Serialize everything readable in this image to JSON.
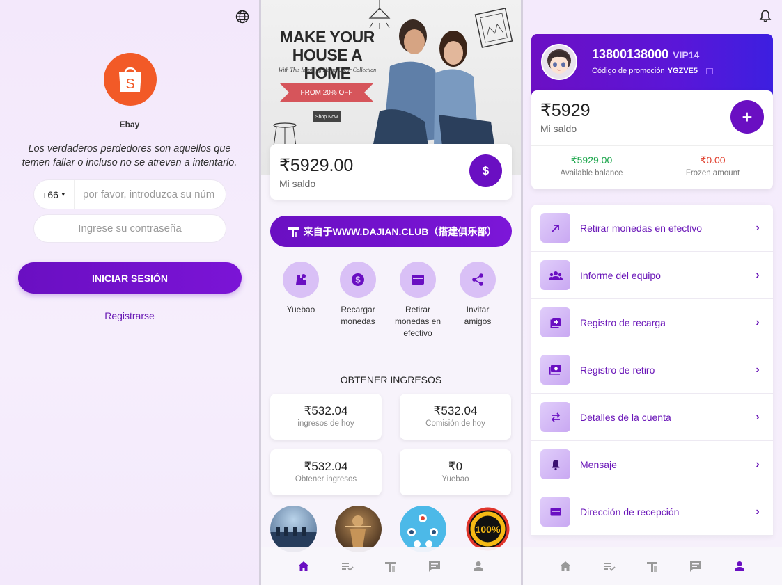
{
  "login": {
    "brand": "Ebay",
    "quote": "Los verdaderos perdedores son aquellos que temen fallar o incluso no se atreven a intentarlo.",
    "country_code": "+66",
    "phone_placeholder": "por favor, introduzca su núm",
    "password_placeholder": "Ingrese su contraseña",
    "login_label": "INICIAR SESIÓN",
    "register_label": "Registrarse"
  },
  "home": {
    "banner": {
      "title": "MAKE YOUR HOUSE A HOME",
      "subtitle": "With This Inspiring Home Decor Collection",
      "badge": "FROM 20% OFF",
      "button": "Shop Now"
    },
    "balance": {
      "amount": "₹5929.00",
      "label": "Mi saldo",
      "button": "$"
    },
    "club_button": "来自于WWW.DAJIAN.CLUB（搭建俱乐部）",
    "quick_actions": [
      {
        "label": "Yuebao",
        "icon": "yuebao-icon"
      },
      {
        "label": "Recargar monedas",
        "icon": "coin-icon"
      },
      {
        "label": "Retirar monedas en efectivo",
        "icon": "card-icon"
      },
      {
        "label": "Invitar amigos",
        "icon": "share-icon"
      }
    ],
    "section_title": "OBTENER INGRESOS",
    "stats": [
      {
        "value": "₹532.04",
        "label": "ingresos de hoy"
      },
      {
        "value": "₹532.04",
        "label": "Comisión de hoy"
      },
      {
        "value": "₹532.04",
        "label": "Obtener ingresos"
      },
      {
        "value": "₹0",
        "label": "Yuebao"
      }
    ],
    "badge_text": "SATISFACTION 100% GUARANTEED"
  },
  "profile": {
    "name": "13800138000",
    "vip": "VIP14",
    "promo_label": "Código de promoción",
    "promo_code": "YGZVE5",
    "balance": "₹5929",
    "balance_label": "Mi saldo",
    "available_value": "₹5929.00",
    "available_label": "Available balance",
    "frozen_value": "₹0.00",
    "frozen_label": "Frozen amount",
    "menu": [
      {
        "label": "Retirar monedas en efectivo",
        "icon": "arrow-up-right-icon"
      },
      {
        "label": "Informe del equipo",
        "icon": "team-icon"
      },
      {
        "label": "Registro de recarga",
        "icon": "add-box-icon"
      },
      {
        "label": "Registro de retiro",
        "icon": "money-icon"
      },
      {
        "label": "Detalles de la cuenta",
        "icon": "swap-icon"
      },
      {
        "label": "Mensaje",
        "icon": "bell-icon"
      },
      {
        "label": "Dirección de recepción",
        "icon": "card-icon"
      }
    ]
  },
  "nav": [
    "home-icon",
    "tasks-icon",
    "service-icon",
    "message-icon",
    "user-icon"
  ],
  "colors": {
    "primary": "#6a0fc2",
    "accent_green": "#1aa54a",
    "accent_red": "#e0412f",
    "brand_orange": "#f25a27"
  }
}
